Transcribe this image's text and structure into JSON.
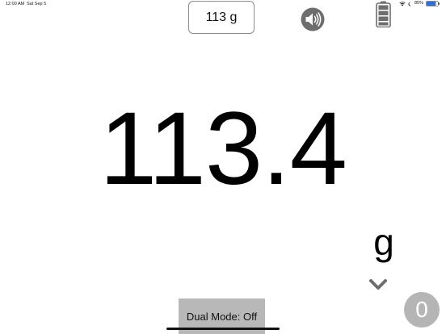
{
  "status_bar": {
    "time": "12:00 AM",
    "date": "Sat Sep 5",
    "battery_percent": "85%",
    "wifi_icon": "wifi-icon",
    "focus_icon": "moon-icon",
    "battery_icon": "battery-icon",
    "battery_level": 0.85,
    "battery_color": "#2f6fd8"
  },
  "toolbar": {
    "weight_display": "113 g",
    "speaker_icon": "speaker-icon",
    "battery_icon": "battery-full-icon"
  },
  "reading": {
    "value": "113.4",
    "unit": "g",
    "unit_chevron_icon": "chevron-down-icon"
  },
  "footer": {
    "dual_mode_label": "Dual Mode: Off",
    "zero_label": "0"
  },
  "colors": {
    "text": "#000000",
    "button_gray": "#b8b8b8",
    "icon_gray": "#6e6e6e"
  }
}
